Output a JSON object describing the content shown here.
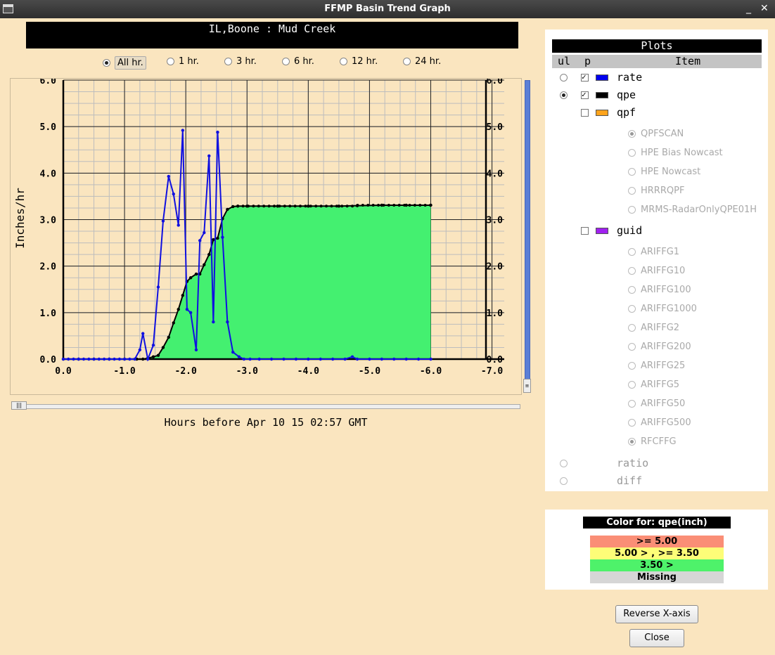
{
  "window": {
    "title": "FFMP Basin Trend Graph",
    "minimize": "_",
    "close": "✕"
  },
  "header": {
    "basin": "IL,Boone : Mud Creek"
  },
  "time_range": {
    "options": [
      "All hr.",
      "1 hr.",
      "3 hr.",
      "6 hr.",
      "12 hr.",
      "24 hr."
    ],
    "selected": "All hr."
  },
  "chart_data": {
    "type": "line",
    "ylabel": "Inches/hr",
    "y_ticks": [
      "0.0",
      "1.0",
      "2.0",
      "3.0",
      "4.0",
      "5.0",
      "6.0"
    ],
    "x_ticks": [
      "0.0",
      "-1.0",
      "-2.0",
      "-3.0",
      "-4.0",
      "-5.0",
      "-6.0",
      "-7.0"
    ],
    "xlim": [
      0,
      -7.2
    ],
    "ylim": [
      0,
      6
    ],
    "grid": true,
    "x_caption": "Hours before Apr 10 15 02:57 GMT",
    "series": [
      {
        "name": "rate",
        "color": "#1010e0",
        "points": [
          [
            0,
            0
          ],
          [
            -0.083,
            0
          ],
          [
            -0.167,
            0
          ],
          [
            -0.25,
            0
          ],
          [
            -0.333,
            0
          ],
          [
            -0.417,
            0
          ],
          [
            -0.5,
            0
          ],
          [
            -0.583,
            0
          ],
          [
            -0.667,
            0
          ],
          [
            -0.75,
            0
          ],
          [
            -0.833,
            0
          ],
          [
            -0.917,
            0
          ],
          [
            -1.0,
            0
          ],
          [
            -1.083,
            0
          ],
          [
            -1.167,
            0
          ],
          [
            -1.25,
            0.2
          ],
          [
            -1.3,
            0.55
          ],
          [
            -1.38,
            0.0
          ],
          [
            -1.47,
            0.3
          ],
          [
            -1.55,
            1.55
          ],
          [
            -1.63,
            2.97
          ],
          [
            -1.72,
            3.93
          ],
          [
            -1.8,
            3.55
          ],
          [
            -1.88,
            2.88
          ],
          [
            -1.95,
            4.92
          ],
          [
            -2.02,
            1.07
          ],
          [
            -2.08,
            1.0
          ],
          [
            -2.17,
            0.2
          ],
          [
            -2.23,
            2.55
          ],
          [
            -2.3,
            2.72
          ],
          [
            -2.38,
            4.37
          ],
          [
            -2.45,
            0.8
          ],
          [
            -2.52,
            4.88
          ],
          [
            -2.6,
            2.62
          ],
          [
            -2.68,
            0.8
          ],
          [
            -2.77,
            0.15
          ],
          [
            -2.87,
            0.05
          ],
          [
            -2.95,
            0
          ],
          [
            -3.05,
            0
          ],
          [
            -3.2,
            0
          ],
          [
            -3.4,
            0
          ],
          [
            -3.6,
            0
          ],
          [
            -3.8,
            0
          ],
          [
            -4.0,
            0
          ],
          [
            -4.2,
            0
          ],
          [
            -4.4,
            0
          ],
          [
            -4.6,
            0
          ],
          [
            -4.72,
            0.05
          ],
          [
            -4.8,
            0
          ],
          [
            -5.0,
            0
          ],
          [
            -5.2,
            0
          ],
          [
            -5.4,
            0
          ],
          [
            -5.6,
            0
          ],
          [
            -5.8,
            0
          ],
          [
            -6.0,
            0
          ]
        ]
      },
      {
        "name": "qpe",
        "color": "#000000",
        "fill": "#44f070",
        "points": [
          [
            0,
            0
          ],
          [
            -0.25,
            0
          ],
          [
            -0.5,
            0
          ],
          [
            -0.75,
            0
          ],
          [
            -1.0,
            0
          ],
          [
            -1.2,
            0
          ],
          [
            -1.3,
            0
          ],
          [
            -1.38,
            0.02
          ],
          [
            -1.47,
            0.05
          ],
          [
            -1.55,
            0.08
          ],
          [
            -1.63,
            0.25
          ],
          [
            -1.72,
            0.47
          ],
          [
            -1.8,
            0.78
          ],
          [
            -1.88,
            1.07
          ],
          [
            -1.95,
            1.37
          ],
          [
            -2.02,
            1.67
          ],
          [
            -2.08,
            1.75
          ],
          [
            -2.17,
            1.83
          ],
          [
            -2.23,
            1.83
          ],
          [
            -2.3,
            2.03
          ],
          [
            -2.38,
            2.25
          ],
          [
            -2.45,
            2.57
          ],
          [
            -2.52,
            2.6
          ],
          [
            -2.6,
            3.02
          ],
          [
            -2.68,
            3.22
          ],
          [
            -2.77,
            3.28
          ],
          [
            -2.85,
            3.29
          ],
          [
            -3.0,
            3.29
          ],
          [
            -3.5,
            3.29
          ],
          [
            -4.0,
            3.29
          ],
          [
            -4.5,
            3.29
          ],
          [
            -4.8,
            3.3
          ],
          [
            -5.2,
            3.31
          ],
          [
            -5.6,
            3.31
          ],
          [
            -6.0,
            3.31
          ]
        ]
      }
    ]
  },
  "plots": {
    "title": "Plots",
    "col_ul": "ul",
    "col_p": "p",
    "col_item": "Item",
    "items": [
      {
        "label": "rate",
        "ul": false,
        "p": true,
        "color": "#0000ee"
      },
      {
        "label": "qpe",
        "ul": true,
        "p": true,
        "color": "#000000"
      },
      {
        "label": "qpf",
        "p": false,
        "color": "#ffa41c"
      },
      {
        "label": "guid",
        "p": false,
        "color": "#a020f0"
      }
    ],
    "qpf_sources": [
      "QPFSCAN",
      "HPE Bias Nowcast",
      "HPE Nowcast",
      "HRRRQPF",
      "MRMS-RadarOnlyQPE01H"
    ],
    "qpf_selected": "QPFSCAN",
    "guid_sources": [
      "ARIFFG1",
      "ARIFFG10",
      "ARIFFG100",
      "ARIFFG1000",
      "ARIFFG2",
      "ARIFFG200",
      "ARIFFG25",
      "ARIFFG5",
      "ARIFFG50",
      "ARIFFG500",
      "RFCFFG"
    ],
    "guid_selected": "RFCFFG",
    "extra": [
      "ratio",
      "diff"
    ]
  },
  "color_legend": {
    "title": "Color for: qpe(inch)",
    "rows": [
      {
        "label": ">= 5.00",
        "color": "#fa8e76"
      },
      {
        "label": "5.00 > , >= 3.50",
        "color": "#fdfd78"
      },
      {
        "label": "3.50 >",
        "color": "#4ef26a"
      },
      {
        "label": "Missing",
        "color": "#d6d6d6"
      }
    ]
  },
  "buttons": {
    "reverse": "Reverse X-axis",
    "close": "Close"
  }
}
